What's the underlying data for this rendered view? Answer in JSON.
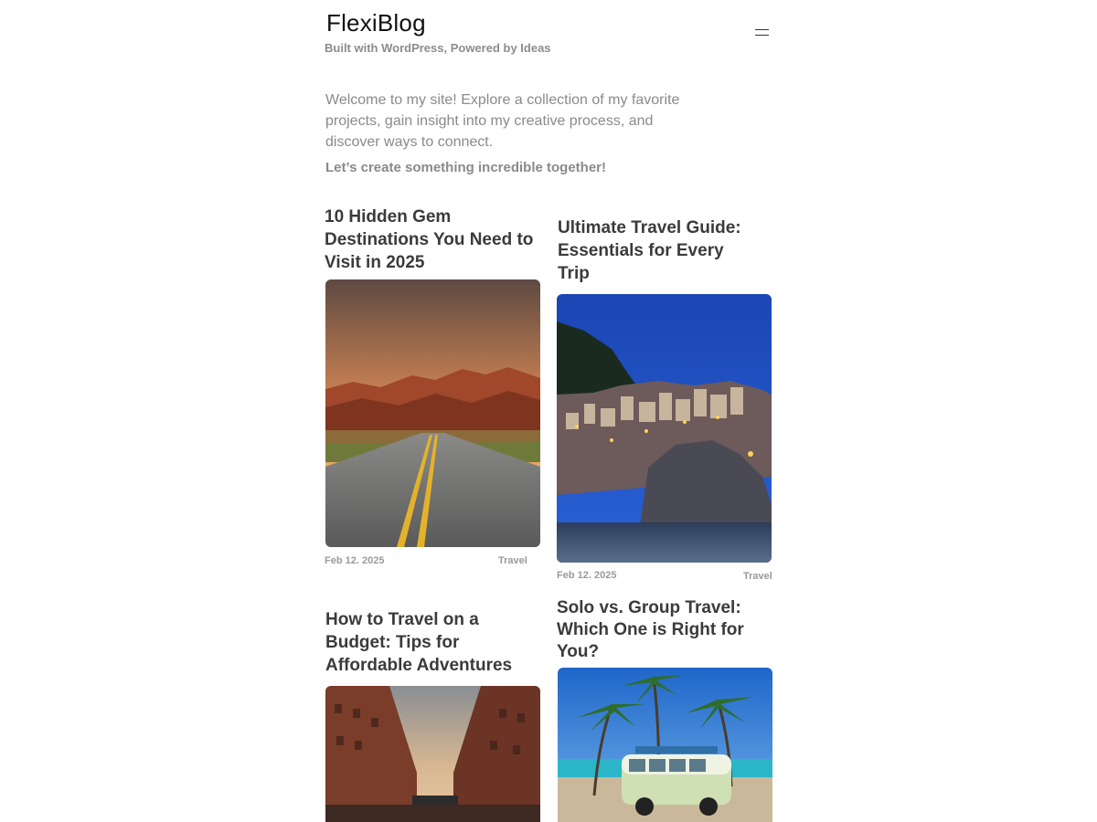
{
  "header": {
    "site_title": "FlexiBlog",
    "tagline": "Built with WordPress, Powered by Ideas"
  },
  "intro": {
    "text": "Welcome to my site! Explore a collection of my favorite projects, gain insight into my creative process, and discover ways to connect.",
    "cta": "Let’s create something incredible together!"
  },
  "posts": [
    {
      "title": "10 Hidden Gem Destinations You Need to Visit in 2025",
      "date": "Feb 12. 2025",
      "category": "Travel"
    },
    {
      "title": "Ultimate Travel Guide: Essentials for Every Trip",
      "date": "Feb 12. 2025",
      "category": "Travel"
    },
    {
      "title": "How to Travel on a Budget: Tips for Affordable Adventures"
    },
    {
      "title": "Solo vs. Group Travel: Which One is Right for You?"
    }
  ],
  "icons": {
    "menu": "hamburger-menu-icon"
  },
  "colors": {
    "text": "#3b3b3b",
    "muted": "#8a8a8a",
    "background": "#ffffff"
  }
}
